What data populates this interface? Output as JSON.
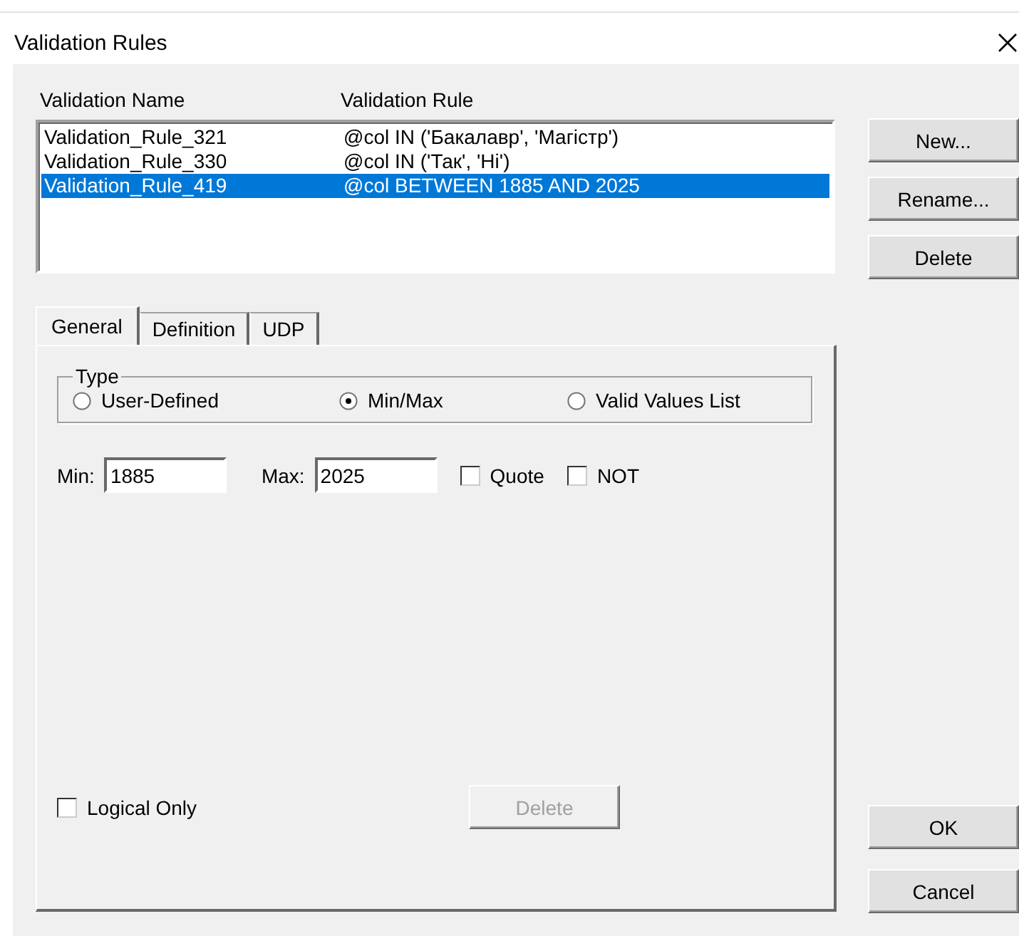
{
  "window": {
    "title": "Validation Rules"
  },
  "list": {
    "columns": [
      "Validation Name",
      "Validation Rule"
    ],
    "rows": [
      {
        "name": "Validation_Rule_321",
        "rule": "@col IN ('Бакалавр', 'Магістр')",
        "selected": false
      },
      {
        "name": "Validation_Rule_330",
        "rule": "@col IN ('Так', 'Ні')",
        "selected": false
      },
      {
        "name": "Validation_Rule_419",
        "rule": "@col BETWEEN 1885 AND 2025",
        "selected": true
      }
    ]
  },
  "side_buttons": [
    "New...",
    "Rename...",
    "Delete"
  ],
  "tabs": [
    {
      "label": "General",
      "selected": true
    },
    {
      "label": "Definition",
      "selected": false
    },
    {
      "label": "UDP",
      "selected": false
    }
  ],
  "type_group": {
    "label": "Type",
    "options": [
      {
        "label": "User-Defined",
        "selected": false
      },
      {
        "label": "Min/Max",
        "selected": true
      },
      {
        "label": "Valid Values List",
        "selected": false
      }
    ]
  },
  "min": {
    "label": "Min:",
    "value": "1885"
  },
  "max": {
    "label": "Max:",
    "value": "2025"
  },
  "checks": [
    {
      "label": "Quote",
      "checked": false
    },
    {
      "label": "NOT",
      "checked": false
    }
  ],
  "logical_only": {
    "label": "Logical Only",
    "checked": false
  },
  "delete_button": {
    "label": "Delete",
    "disabled": true
  },
  "dialog_buttons": [
    "OK",
    "Cancel"
  ]
}
